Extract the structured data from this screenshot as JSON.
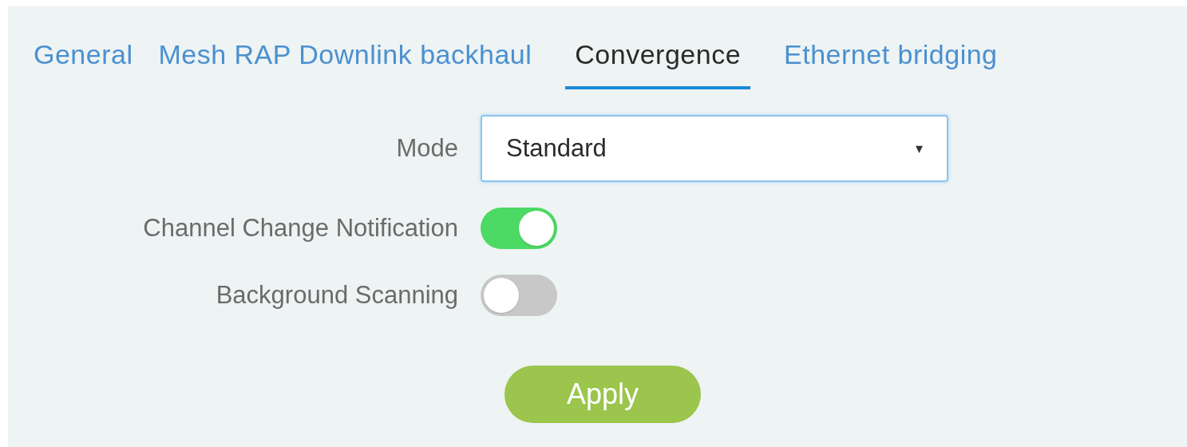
{
  "tabs": [
    {
      "label": "General",
      "selected": false
    },
    {
      "label": "Mesh RAP Downlink backhaul",
      "selected": false
    },
    {
      "label": "Convergence",
      "selected": true
    },
    {
      "label": "Ethernet bridging",
      "selected": false
    }
  ],
  "form": {
    "rows": [
      {
        "kind": "select",
        "label": "Mode",
        "value": "Standard",
        "caret": "▾"
      },
      {
        "kind": "toggle",
        "label": "Channel Change Notification",
        "on": true
      },
      {
        "kind": "toggle",
        "label": "Background Scanning",
        "on": false
      }
    ],
    "apply_button": "Apply"
  }
}
